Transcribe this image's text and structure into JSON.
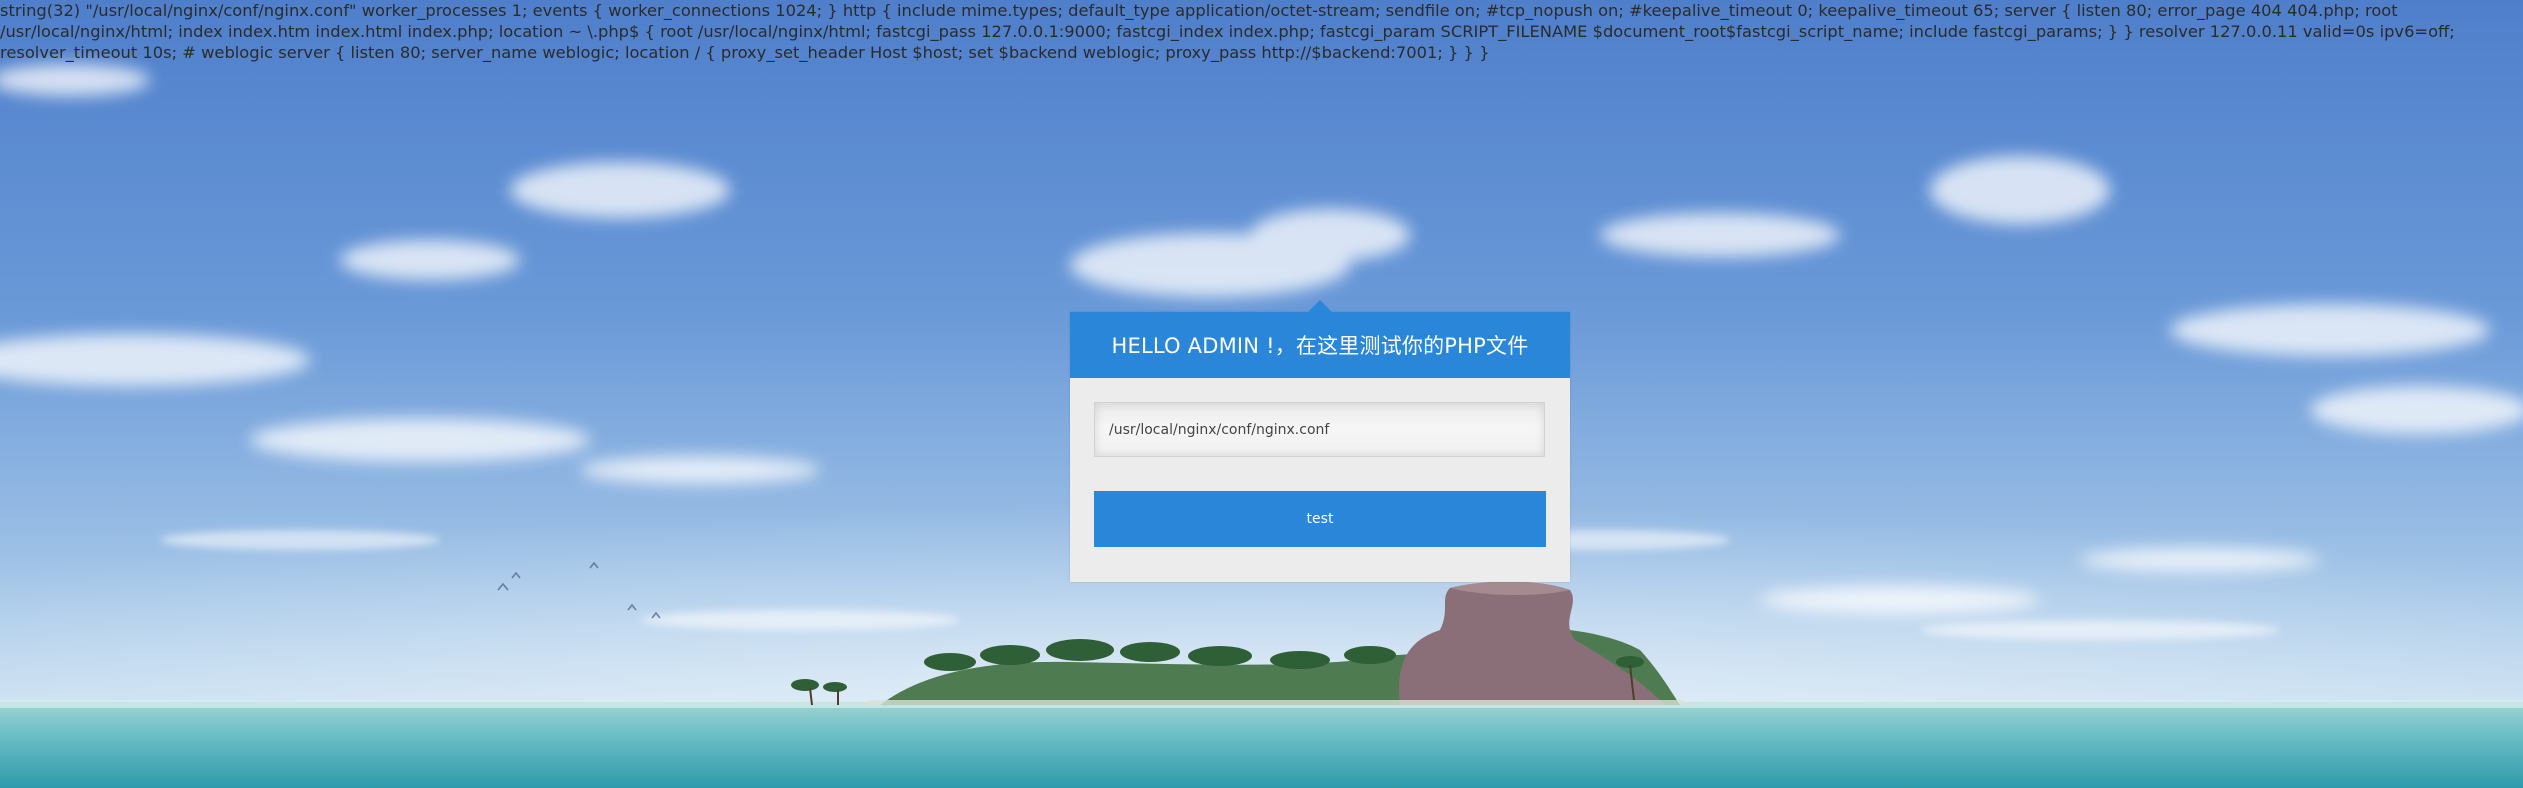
{
  "debug_output": "string(32) \"/usr/local/nginx/conf/nginx.conf\" worker_processes 1; events { worker_connections 1024; } http { include mime.types; default_type application/octet-stream; sendfile on; #tcp_nopush on; #keepalive_timeout 0; keepalive_timeout 65; server { listen 80; error_page 404 404.php; root /usr/local/nginx/html; index index.htm index.html index.php; location ~ \\.php$ { root /usr/local/nginx/html; fastcgi_pass 127.0.0.1:9000; fastcgi_index index.php; fastcgi_param SCRIPT_FILENAME $document_root$fastcgi_script_name; include fastcgi_params; } } resolver 127.0.0.11 valid=0s ipv6=off; resolver_timeout 10s; # weblogic server { listen 80; server_name weblogic; location / { proxy_set_header Host $host; set $backend weblogic; proxy_pass http://$backend:7001; } } }",
  "card": {
    "title": "HELLO ADMIN !，在这里测试你的PHP文件",
    "input_value": "/usr/local/nginx/conf/nginx.conf",
    "button_label": "test"
  },
  "colors": {
    "accent": "#2a86d8",
    "card_background": "#ececec",
    "text": "#2b2b2b"
  }
}
